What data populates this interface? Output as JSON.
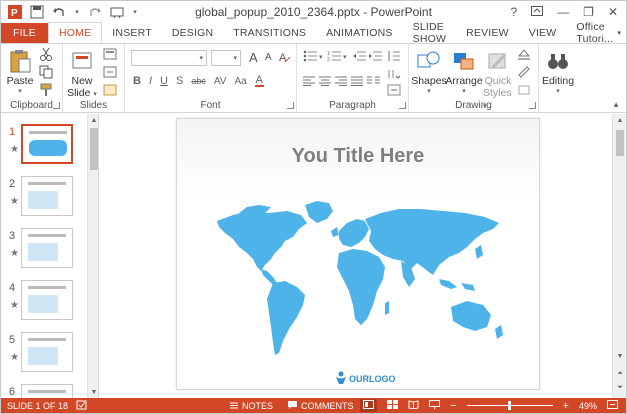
{
  "window": {
    "title": "global_popup_2010_2364.pptx - PowerPoint",
    "help": "?",
    "minimize": "—",
    "restore": "❐",
    "close": "✕"
  },
  "tabs": [
    {
      "label": "FILE"
    },
    {
      "label": "HOME"
    },
    {
      "label": "INSERT"
    },
    {
      "label": "DESIGN"
    },
    {
      "label": "TRANSITIONS"
    },
    {
      "label": "ANIMATIONS"
    },
    {
      "label": "SLIDE SHOW"
    },
    {
      "label": "REVIEW"
    },
    {
      "label": "VIEW"
    }
  ],
  "account": "Office Tutori...",
  "ribbon": {
    "clipboard": {
      "label": "Clipboard",
      "paste": "Paste"
    },
    "slides": {
      "label": "Slides",
      "new_slide_1": "New",
      "new_slide_2": "Slide"
    },
    "font": {
      "label": "Font",
      "bold": "B",
      "italic": "I",
      "underline": "U",
      "strike": "S",
      "shadow": "abc",
      "spacing": "AV",
      "case": "Aa",
      "grow": "A",
      "shrink": "A"
    },
    "paragraph": {
      "label": "Paragraph"
    },
    "drawing": {
      "label": "Drawing",
      "shapes": "Shapes",
      "arrange": "Arrange",
      "quick_1": "Quick",
      "quick_2": "Styles"
    },
    "editing": {
      "label": "Editing"
    }
  },
  "thumbnails": [
    {
      "num": "1",
      "star": "★",
      "selected": true
    },
    {
      "num": "2",
      "star": "★",
      "selected": false
    },
    {
      "num": "3",
      "star": "★",
      "selected": false
    },
    {
      "num": "4",
      "star": "★",
      "selected": false
    },
    {
      "num": "5",
      "star": "★",
      "selected": false
    },
    {
      "num": "6",
      "star": "",
      "selected": false
    }
  ],
  "slide": {
    "title": "You Title Here",
    "logo_text": "OURLOGO",
    "map_color": "#4db3e8"
  },
  "status": {
    "slide_info": "SLIDE 1 OF 18",
    "notes": "NOTES",
    "comments": "COMMENTS",
    "zoom": "49%",
    "zoom_level": 0.49
  },
  "colors": {
    "accent": "#d24726",
    "map": "#4db3e8"
  }
}
